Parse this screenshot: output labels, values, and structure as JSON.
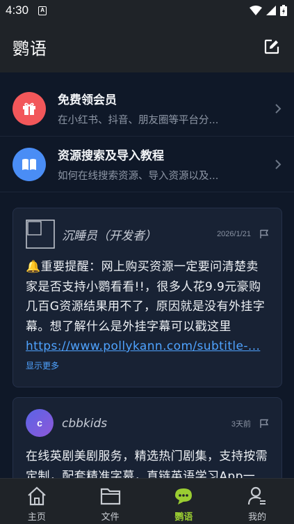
{
  "status_bar": {
    "time": "4:30",
    "notification_glyph": "A"
  },
  "header": {
    "title": "鹦语",
    "edit_icon": "edit-icon"
  },
  "promos": [
    {
      "title": "免费领会员",
      "subtitle": "在小红书、抖音、朋友圈等平台分...",
      "icon": "gift-icon",
      "color": "#f2575a"
    },
    {
      "title": "资源搜索及导入教程",
      "subtitle": "如何在线搜索资源、导入资源以及...",
      "icon": "book-icon",
      "color": "#4a8df5"
    }
  ],
  "posts": [
    {
      "author": "沉睡员（开发者）",
      "date": "2026/1/21",
      "body": "🔔重要提醒：网上购买资源一定要问清楚卖家是否支持小鹦看看!!，很多人花9.9元豪购几百G资源结果用不了，原因就是没有外挂字幕。想了解什么是外挂字幕可以戳这里",
      "link": "https://www.pollykann.com/subtitle-...",
      "show_more": "显示更多"
    },
    {
      "author": "cbbkids",
      "avatar_letter": "c",
      "date": "3天前",
      "body": "在线英剧美剧服务，精选热门剧集，支持按需定制，配套精准字幕，直链英语学习App一"
    }
  ],
  "tabs": [
    {
      "label": "主页",
      "icon": "home-icon",
      "active": false
    },
    {
      "label": "文件",
      "icon": "folder-icon",
      "active": false
    },
    {
      "label": "鹦语",
      "icon": "chat-icon",
      "active": true
    },
    {
      "label": "我的",
      "icon": "profile-icon",
      "active": false
    }
  ],
  "colors": {
    "accent": "#9acd32",
    "link": "#4fa3ff",
    "background": "#0f1828",
    "bar": "#1f2328"
  }
}
